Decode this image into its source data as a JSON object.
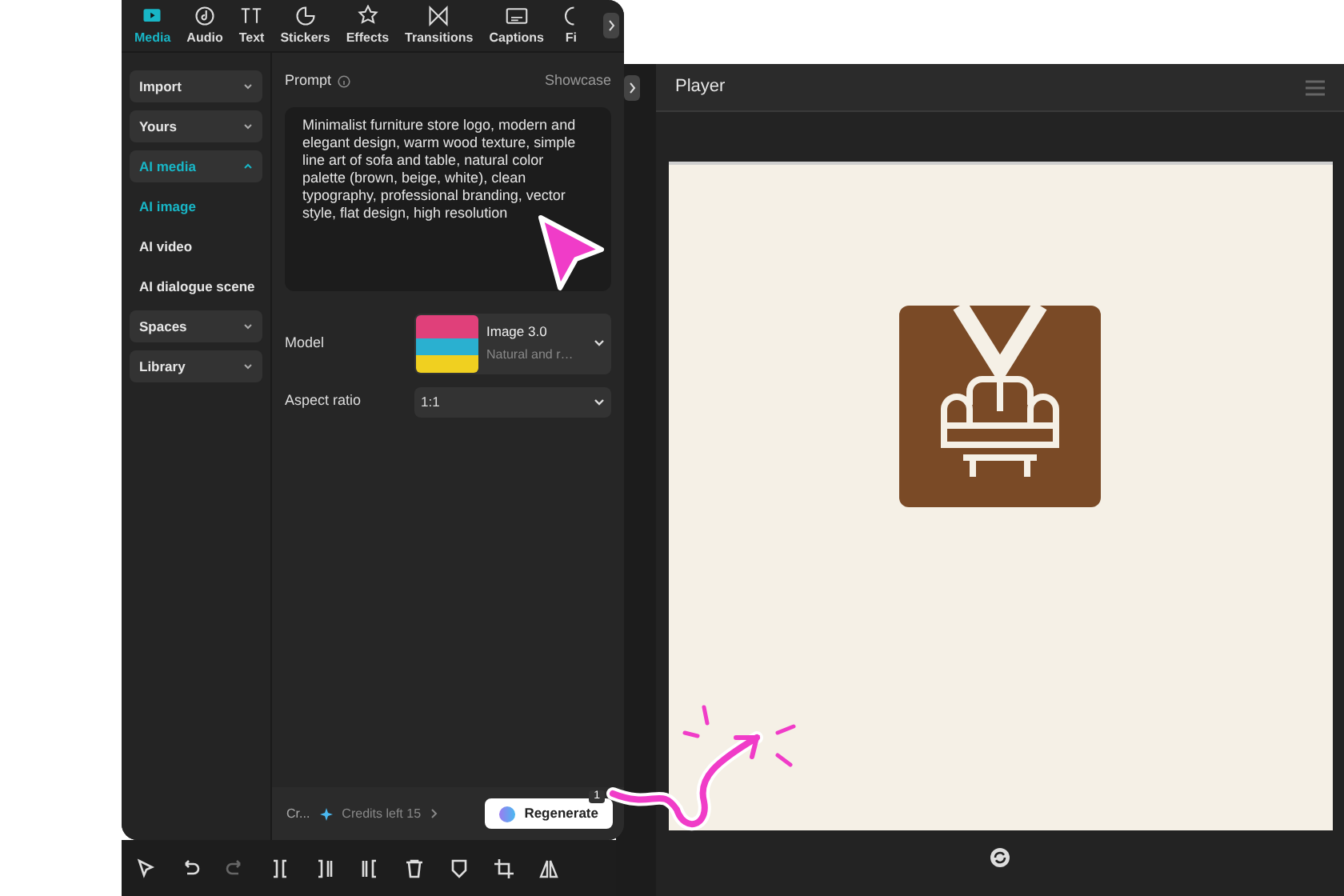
{
  "tabs": [
    {
      "label": "Media",
      "selected": true
    },
    {
      "label": "Audio",
      "selected": false
    },
    {
      "label": "Text",
      "selected": false
    },
    {
      "label": "Stickers",
      "selected": false
    },
    {
      "label": "Effects",
      "selected": false
    },
    {
      "label": "Transitions",
      "selected": false
    },
    {
      "label": "Captions",
      "selected": false
    },
    {
      "label": "Fi",
      "selected": false
    }
  ],
  "sidebar": {
    "items": [
      {
        "kind": "group",
        "label": "Import",
        "expanded": false,
        "selected": false
      },
      {
        "kind": "group",
        "label": "Yours",
        "expanded": false,
        "selected": false
      },
      {
        "kind": "group",
        "label": "AI media",
        "expanded": true,
        "selected": true
      },
      {
        "kind": "sub",
        "label": "AI image",
        "selected": true
      },
      {
        "kind": "sub",
        "label": "AI video",
        "selected": false
      },
      {
        "kind": "sub",
        "label": "AI dialogue scene",
        "selected": false
      },
      {
        "kind": "group",
        "label": "Spaces",
        "expanded": false,
        "selected": false
      },
      {
        "kind": "group",
        "label": "Library",
        "expanded": false,
        "selected": false
      }
    ]
  },
  "prompt": {
    "label": "Prompt",
    "link": "Showcase",
    "value": "Minimalist furniture store logo, modern and elegant design, warm wood texture, simple line art of sofa and table, natural color palette (brown, beige, white), clean typography, professional branding, vector style, flat design, high resolution"
  },
  "model": {
    "label": "Model",
    "name": "Image 3.0",
    "description": "Natural and r…"
  },
  "aspect_ratio": {
    "label": "Aspect ratio",
    "value": "1:1"
  },
  "footer": {
    "label": "Cr...",
    "credits": "Credits left 15",
    "button": "Regenerate",
    "badge": "1"
  },
  "player": {
    "title": "Player"
  }
}
